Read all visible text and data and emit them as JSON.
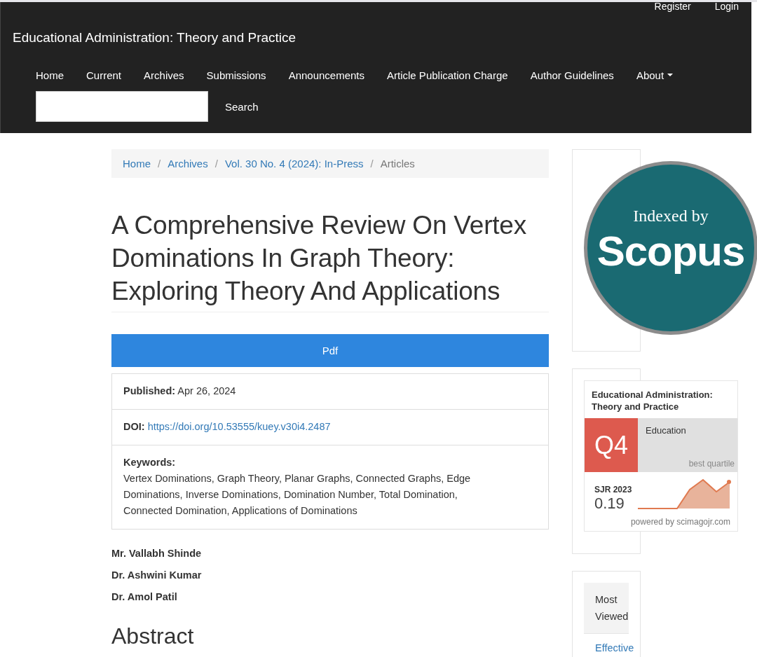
{
  "header": {
    "user_links": [
      {
        "label": "Register"
      },
      {
        "label": "Login"
      }
    ],
    "site_title": "Educational Administration: Theory and Practice",
    "nav": [
      {
        "label": "Home",
        "dropdown": false
      },
      {
        "label": "Current",
        "dropdown": false
      },
      {
        "label": "Archives",
        "dropdown": false
      },
      {
        "label": "Submissions",
        "dropdown": false
      },
      {
        "label": "Announcements",
        "dropdown": false
      },
      {
        "label": "Article Publication Charge",
        "dropdown": false
      },
      {
        "label": "Author Guidelines",
        "dropdown": false
      },
      {
        "label": "About",
        "dropdown": true
      }
    ],
    "search": {
      "button": "Search"
    }
  },
  "breadcrumb_separator": "/",
  "breadcrumb": [
    {
      "label": "Home",
      "current": false
    },
    {
      "label": "Archives",
      "current": false
    },
    {
      "label": "Vol. 30 No. 4 (2024): In-Press",
      "current": false
    },
    {
      "label": "Articles",
      "current": true
    }
  ],
  "article": {
    "title": "A Comprehensive Review On Vertex Dominations In Graph Theory: Exploring Theory And Applications",
    "galley": "Pdf",
    "details": [
      {
        "kind": "text",
        "label": "Published:",
        "value": "Apr 26, 2024"
      },
      {
        "kind": "link",
        "label": "DOI:",
        "value": "https://doi.org/10.53555/kuey.v30i4.2487"
      },
      {
        "kind": "block",
        "label": "Keywords:",
        "value": "Vertex Dominations, Graph Theory, Planar Graphs, Connected Graphs, Edge Dominations, Inverse Dominations, Domination Number, Total Domination, Connected Domination, Applications of Dominations"
      }
    ],
    "authors": [
      "Mr. Vallabh Shinde",
      "Dr. Ashwini Kumar",
      "Dr. Amol Patil"
    ],
    "abstract_heading": "Abstract"
  },
  "sidebar": {
    "scopus_badge": {
      "line_1": "Indexed by",
      "line_2": "Scopus"
    },
    "sjr_widget": {
      "journal": "Educational Administration: Theory and Practice",
      "quartile": "Q4",
      "category": "Education",
      "quartile_note": "best quartile",
      "metric": "SJR 2023",
      "value": "0.19",
      "footer": "powered by scimagojr.com"
    },
    "most_viewed": {
      "tabs": [
        {
          "label": "Most Viewed",
          "selected": true
        }
      ],
      "first_link": "Effective"
    }
  }
}
